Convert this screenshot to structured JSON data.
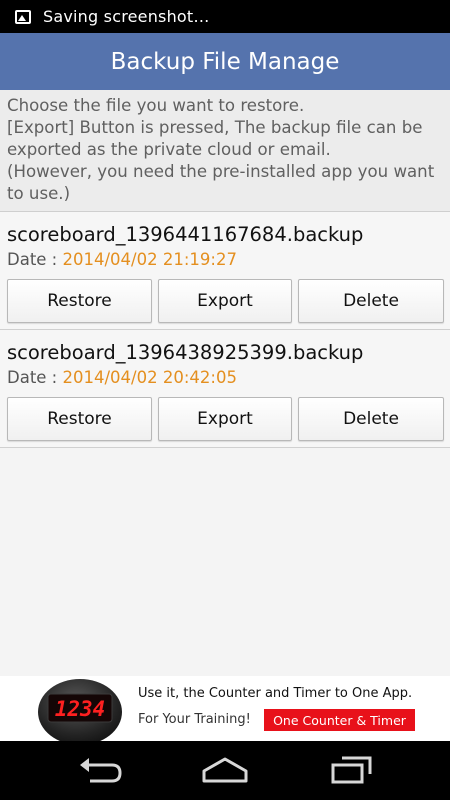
{
  "status_bar": {
    "text": "Saving screenshot…",
    "icon": "image-icon"
  },
  "header": {
    "title": "Backup File Manage"
  },
  "info": {
    "lines": [
      "Choose the file you want to restore.",
      "[Export] Button is pressed, The backup file can be",
      "exported as the private cloud or email.",
      "(However, you need the pre-installed app you want",
      "to use.)"
    ]
  },
  "backups": [
    {
      "filename": "scoreboard_1396441167684.backup",
      "date_label": "Date : ",
      "date_value": "2014/04/02 21:19:27",
      "restore_label": "Restore",
      "export_label": "Export",
      "delete_label": "Delete"
    },
    {
      "filename": "scoreboard_1396438925399.backup",
      "date_label": "Date : ",
      "date_value": "2014/04/02 20:42:05",
      "restore_label": "Restore",
      "export_label": "Export",
      "delete_label": "Delete"
    }
  ],
  "ad": {
    "counter_display": "1234",
    "line1": "Use it, the Counter and Timer to One App.",
    "line2": "For Your Training!",
    "cta": "One Counter & Timer"
  },
  "nav": {
    "icons": [
      "back-icon",
      "home-icon",
      "recents-icon"
    ]
  },
  "colors": {
    "title_bar": "#5573ad",
    "date_value": "#e48f1f",
    "ad_cta": "#e8111a",
    "counter_digits": "#ff2020"
  }
}
